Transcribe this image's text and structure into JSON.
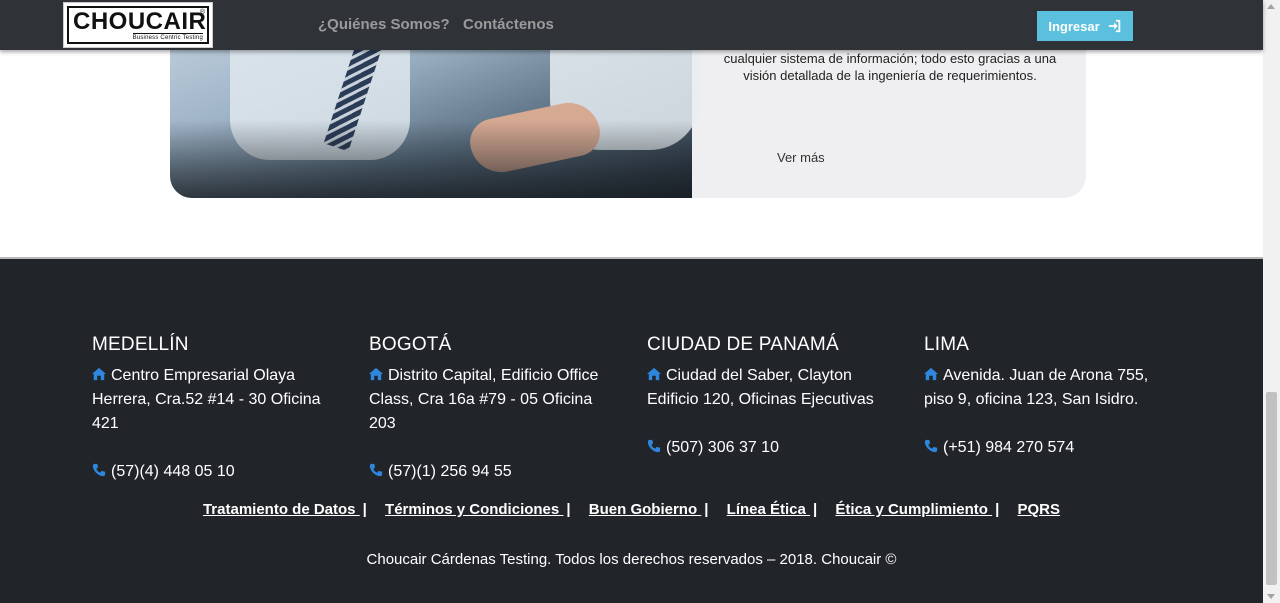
{
  "header": {
    "logo_text": "CHOUCAIR",
    "logo_reg": "®",
    "logo_tagline": "Business Centric Testing",
    "nav": [
      {
        "label": "¿Quiénes Somos?"
      },
      {
        "label": "Contáctenos"
      }
    ],
    "login_label": "Ingresar",
    "login_color": "#5bc0de"
  },
  "card": {
    "text": "cualquier sistema de información; todo esto gracias a una visión detallada de la ingeniería de requerimientos.",
    "link_label": "Ver más"
  },
  "footer": {
    "offices": [
      {
        "city": "MEDELLÍN",
        "address": "Centro Empresarial Olaya Herrera, Cra.52 #14 - 30 Oficina 421",
        "phone": "(57)(4) 448 05 10"
      },
      {
        "city": "BOGOTÁ",
        "address": "Distrito Capital, Edificio Office Class, Cra 16a #79 - 05 Oficina 203",
        "phone": "(57)(1) 256 94 55"
      },
      {
        "city": "CIUDAD DE PANAMÁ",
        "address": "Ciudad del Saber, Clayton Edificio 120, Oficinas Ejecutivas",
        "phone": "(507) 306 37 10"
      },
      {
        "city": "LIMA",
        "address": "Avenida. Juan de Arona 755, piso 9, oficina 123, San Isidro.",
        "phone": "(+51) 984 270 574"
      }
    ],
    "links": [
      {
        "label": "Tratamiento de Datos "
      },
      {
        "label": "Términos y Condiciones "
      },
      {
        "label": "Buen Gobierno "
      },
      {
        "label": "Línea Ética "
      },
      {
        "label": "Ética y Cumplimiento "
      },
      {
        "label": "PQRS"
      }
    ],
    "separator": "|",
    "copyright": "Choucair Cárdenas Testing. Todos los derechos reservados – 2018. Choucair ©",
    "icon_color": "#2e86de",
    "background": "#212529"
  }
}
